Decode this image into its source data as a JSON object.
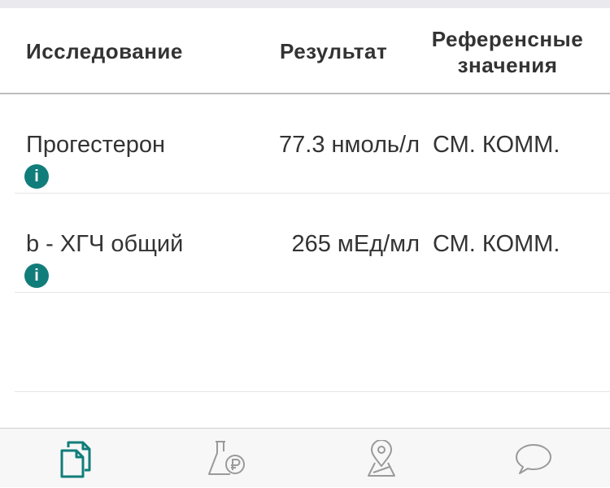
{
  "table": {
    "headers": {
      "study": "Исследование",
      "result": "Результат",
      "reference_line1": "Референсные",
      "reference_line2": "значения"
    },
    "rows": [
      {
        "name": "Прогестерон",
        "value": "77.3 нмоль/л",
        "reference": "СМ. КОММ.",
        "info_icon": "info-icon"
      },
      {
        "name": "b - ХГЧ общий",
        "value": "265 мЕд/мл",
        "reference": "СМ. КОММ.",
        "info_icon": "info-icon"
      }
    ]
  },
  "info_icon_glyph": "i",
  "colors": {
    "accent": "#117d7a",
    "inactive_tab": "#9a9a9a"
  },
  "tab_bar": {
    "tabs": [
      {
        "icon": "documents-icon",
        "active": true
      },
      {
        "icon": "lab-price-icon",
        "active": false
      },
      {
        "icon": "map-pin-icon",
        "active": false
      },
      {
        "icon": "chat-bubble-icon",
        "active": false
      }
    ]
  }
}
